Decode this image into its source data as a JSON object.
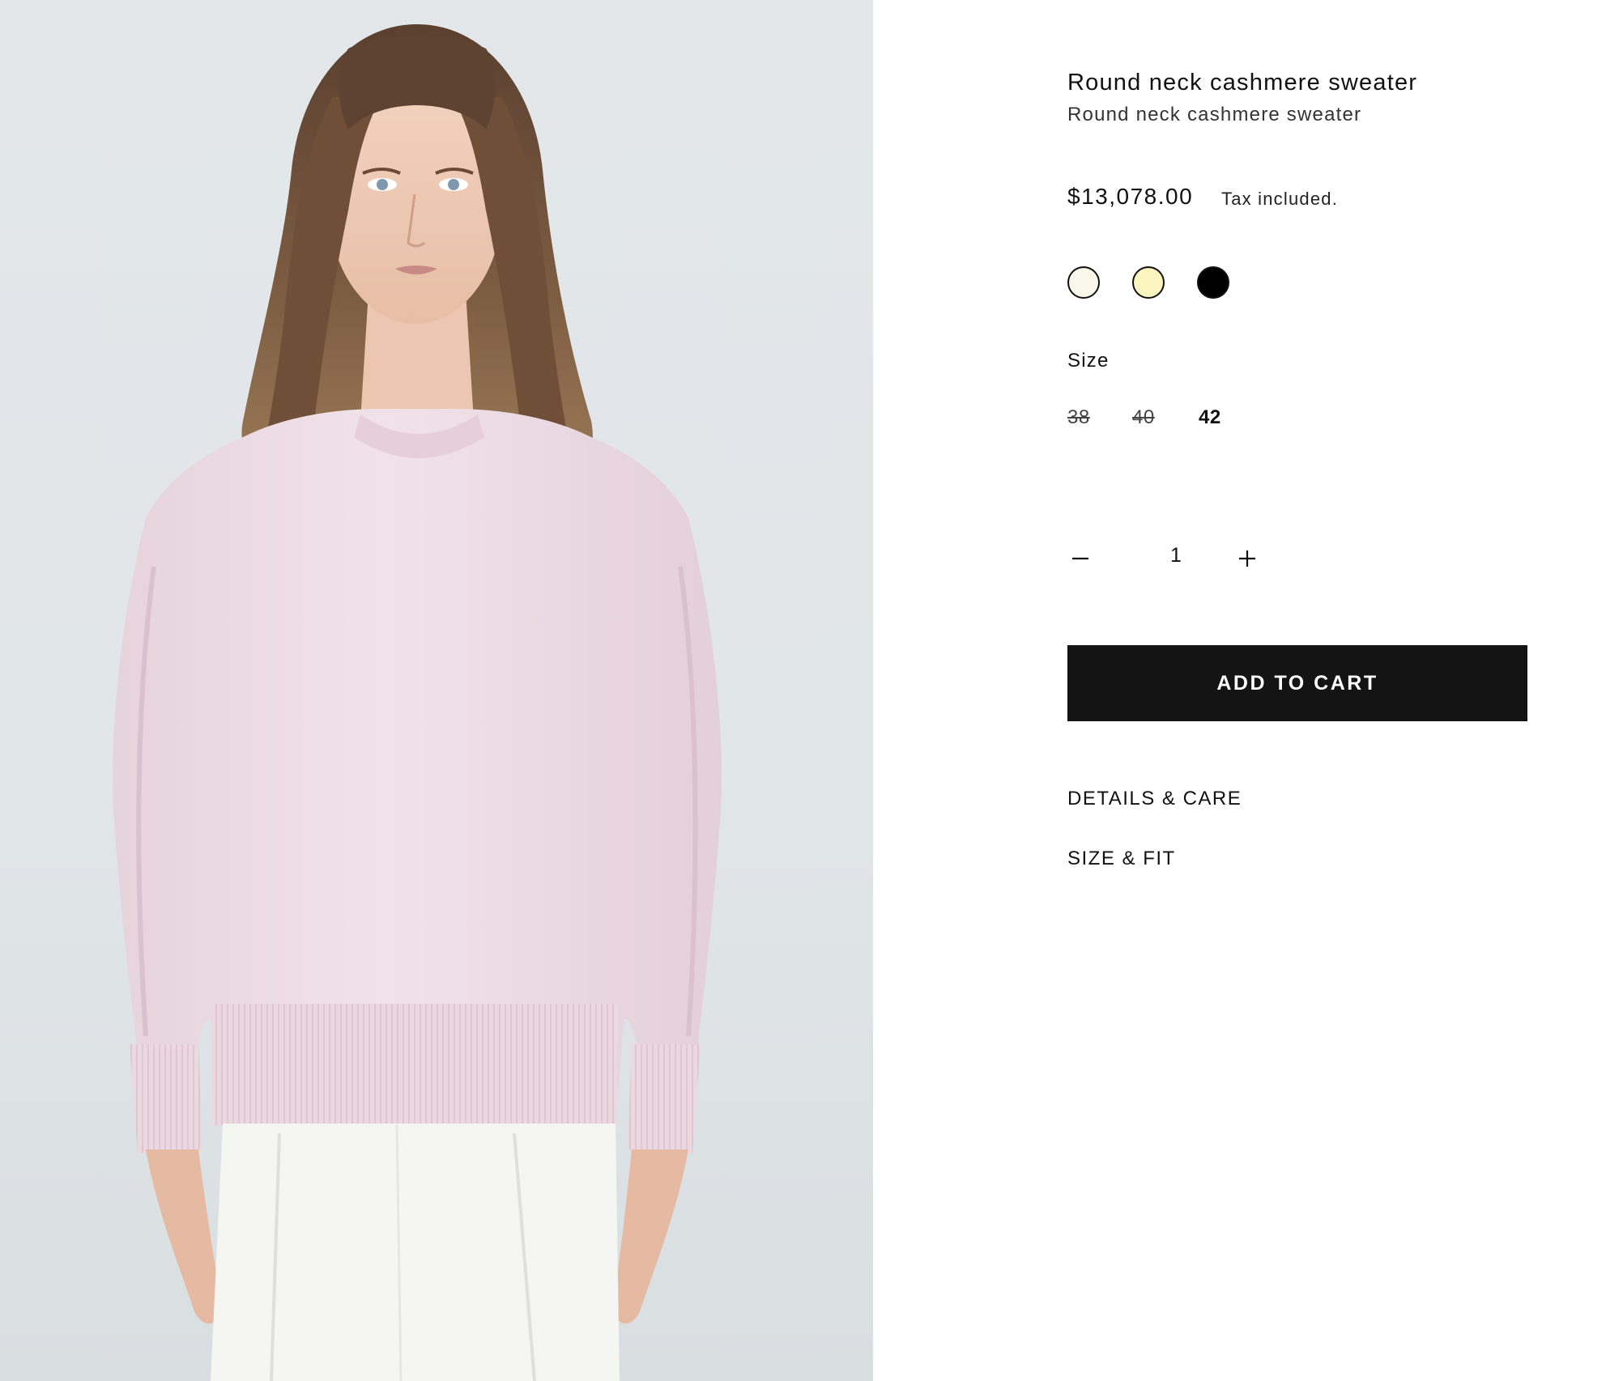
{
  "product": {
    "title": "Round neck cashmere sweater",
    "subtitle": "Round neck cashmere sweater",
    "price": "$13,078.00",
    "tax_note": "Tax included."
  },
  "colors": {
    "swatches": [
      {
        "name": "ivory",
        "hex": "#f8f7ea",
        "selected": true
      },
      {
        "name": "butter yellow",
        "hex": "#fbf3c0",
        "selected": false
      },
      {
        "name": "black",
        "hex": "#000000",
        "selected": false
      }
    ]
  },
  "size_selector": {
    "label": "Size",
    "options": [
      {
        "label": "38",
        "available": false
      },
      {
        "label": "40",
        "available": false
      },
      {
        "label": "42",
        "available": true
      }
    ]
  },
  "quantity": {
    "minus_icon": "minus-icon",
    "value": "1",
    "plus_icon": "plus-icon"
  },
  "cart": {
    "add_label": "ADD TO CART",
    "button_color": "#141414"
  },
  "accordion": {
    "details_label": "DETAILS & CARE",
    "size_fit_label": "SIZE & FIT"
  },
  "image": {
    "sweater_color": "#efdde6",
    "background_color": "#e2e6e9"
  }
}
